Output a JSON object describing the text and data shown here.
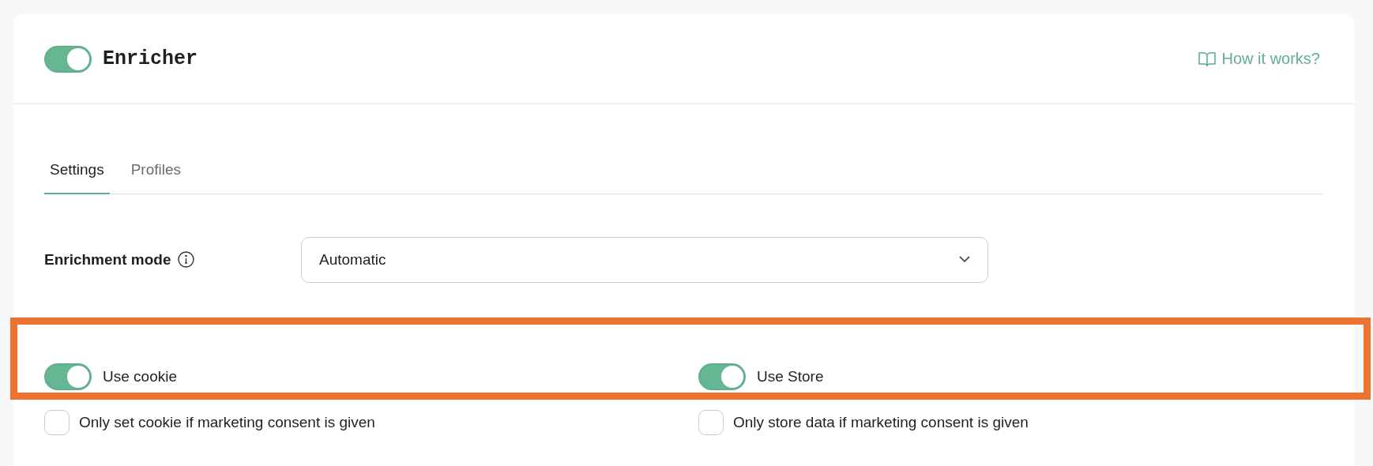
{
  "header": {
    "enabled": true,
    "title": "Enricher",
    "help_link": "How it works?"
  },
  "tabs": [
    {
      "label": "Settings",
      "selected": true
    },
    {
      "label": "Profiles",
      "selected": false
    }
  ],
  "enrichment_mode": {
    "label": "Enrichment mode",
    "value": "Automatic"
  },
  "options": [
    {
      "toggle": {
        "label": "Use cookie",
        "on": true
      },
      "consent": {
        "label": "Only set cookie if marketing consent is given",
        "checked": false
      }
    },
    {
      "toggle": {
        "label": "Use Store",
        "on": true
      },
      "consent": {
        "label": "Only store data if marketing consent is given",
        "checked": false
      }
    }
  ],
  "highlight": {
    "shown": true
  }
}
